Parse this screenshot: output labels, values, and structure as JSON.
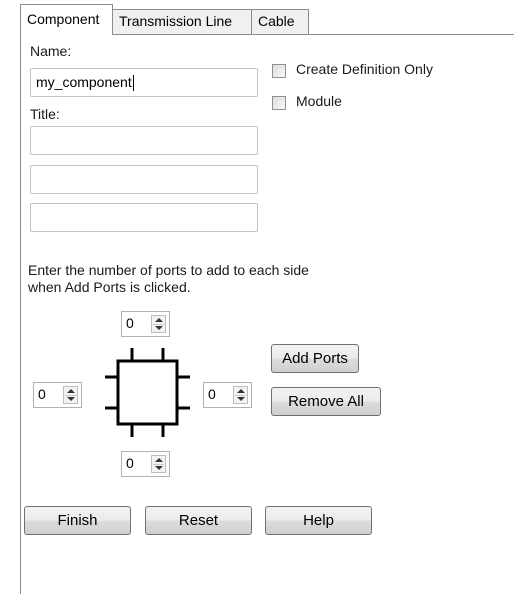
{
  "tabs": [
    {
      "label": "Component",
      "active": true
    },
    {
      "label": "Transmission Line",
      "active": false
    },
    {
      "label": "Cable",
      "active": false
    }
  ],
  "name_label": "Name:",
  "name_value": "my_component",
  "title_label": "Title:",
  "title_fields": [
    "",
    "",
    ""
  ],
  "checkboxes": {
    "create_definition_only": {
      "label": "Create Definition Only",
      "checked": false
    },
    "module": {
      "label": "Module",
      "checked": false
    }
  },
  "instructions_line1": "Enter the number of ports to add to each side",
  "instructions_line2": "when Add Ports is clicked.",
  "ports": {
    "top": "0",
    "left": "0",
    "right": "0",
    "bottom": "0"
  },
  "buttons": {
    "add_ports": "Add Ports",
    "remove_all": "Remove All",
    "finish": "Finish",
    "reset": "Reset",
    "help": "Help"
  }
}
